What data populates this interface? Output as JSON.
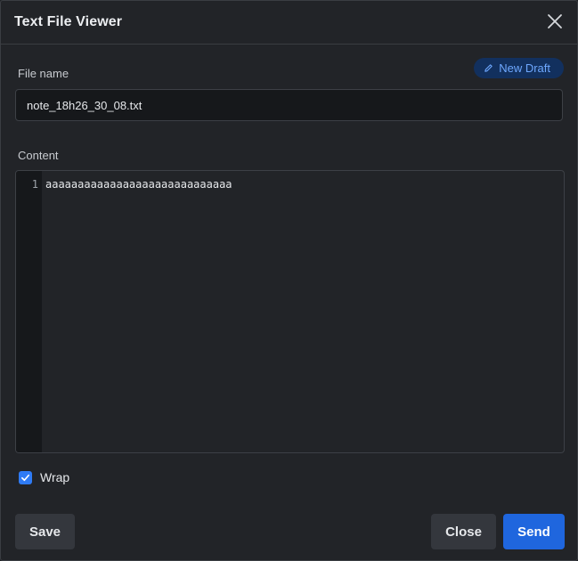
{
  "dialog": {
    "title": "Text File Viewer"
  },
  "file_name": {
    "label": "File name",
    "value": "note_18h26_30_08.txt",
    "badge_label": "New Draft",
    "badge_icon": "pencil-icon"
  },
  "content": {
    "label": "Content",
    "lines": [
      {
        "number": "1",
        "text": "aaaaaaaaaaaaaaaaaaaaaaaaaaaaa"
      }
    ]
  },
  "wrap": {
    "label": "Wrap",
    "checked": true
  },
  "buttons": {
    "save": "Save",
    "close": "Close",
    "send": "Send"
  },
  "colors": {
    "accent": "#1f66de",
    "badge_bg": "#12305e",
    "badge_text": "#6ea8ff",
    "dialog_bg": "#222428"
  }
}
